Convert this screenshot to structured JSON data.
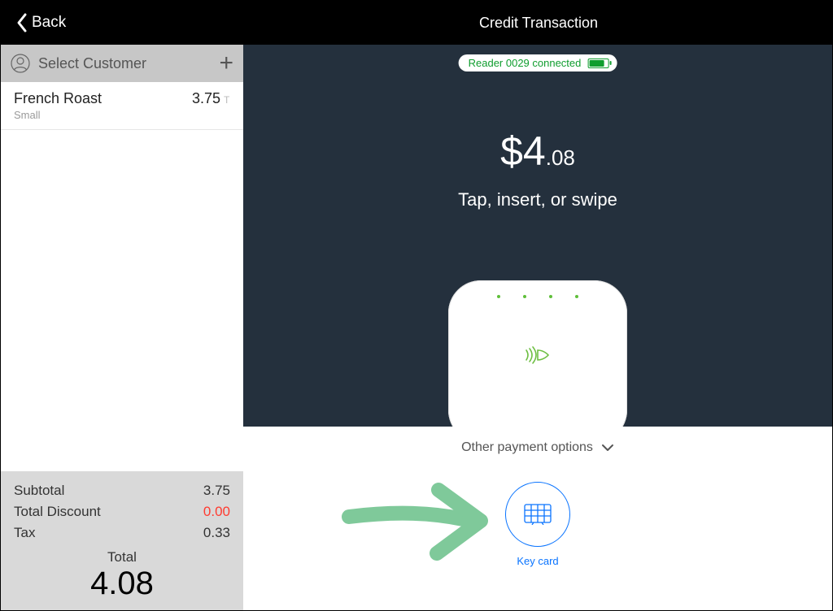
{
  "header": {
    "back_label": "Back",
    "title": "Credit Transaction"
  },
  "sidebar": {
    "customer": {
      "label": "Select Customer"
    },
    "items": [
      {
        "name": "French Roast",
        "price": "3.75",
        "tax_flag": "T",
        "modifier": "Small"
      }
    ],
    "summary": {
      "subtotal_label": "Subtotal",
      "subtotal_value": "3.75",
      "discount_label": "Total Discount",
      "discount_value": "0.00",
      "tax_label": "Tax",
      "tax_value": "0.33",
      "total_label": "Total",
      "total_value": "4.08"
    }
  },
  "reader": {
    "status_text": "Reader 0029 connected"
  },
  "payment": {
    "amount_dollars": "$4",
    "amount_cents": ".08",
    "prompt": "Tap, insert, or swipe",
    "other_options_label": "Other payment options",
    "key_card_label": "Key card"
  }
}
